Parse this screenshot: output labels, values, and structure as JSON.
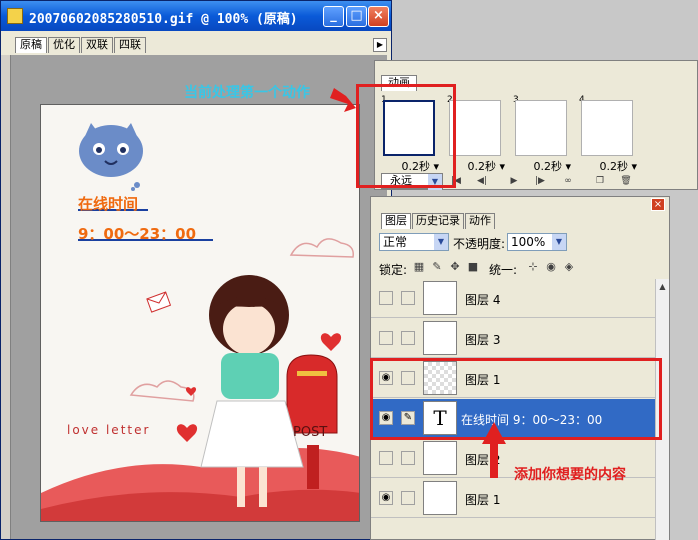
{
  "document": {
    "title": "2007060208528051​0.gif @ 100% (原稿)",
    "tabs": [
      "原稿",
      "优化",
      "双联",
      "四联"
    ],
    "buttons": {
      "minimize": "_",
      "maximize": "□",
      "close": "×"
    }
  },
  "artwork": {
    "online_label": "在线时间",
    "hours": "9：00～23：00",
    "love_letter": "love letter",
    "post_sign": "POST"
  },
  "animation": {
    "tab": "动画",
    "frames": [
      {
        "num": "1",
        "delay": "0.2秒"
      },
      {
        "num": "2",
        "delay": "0.2秒"
      },
      {
        "num": "3",
        "delay": "0.2秒"
      },
      {
        "num": "4",
        "delay": "0.2秒"
      }
    ],
    "loop": "永远"
  },
  "layers_panel": {
    "tabs": [
      "图层",
      "历史记录",
      "动作"
    ],
    "blend_mode": "正常",
    "opacity_label": "不透明度:",
    "opacity": "100%",
    "lock_label": "锁定:",
    "unify_label": "统一:",
    "layers": [
      {
        "name": "图层 4",
        "visible": false
      },
      {
        "name": "图层 3",
        "visible": false
      },
      {
        "name": "图层 1",
        "visible": true
      },
      {
        "name": "在线时间  9：00～23：00",
        "visible": true,
        "selected": true,
        "type": "text"
      },
      {
        "name": "图层 2",
        "visible": false
      },
      {
        "name": "图层 1",
        "visible": true
      }
    ]
  },
  "annotations": {
    "current_frame": "当前处理第一个动作",
    "add_content": "添加你想要的内容"
  },
  "colors": {
    "accent": "#316ac5",
    "annotation_red": "#e02020",
    "art_orange": "#ef6a10",
    "annotation_cyan": "#39c6e6"
  }
}
